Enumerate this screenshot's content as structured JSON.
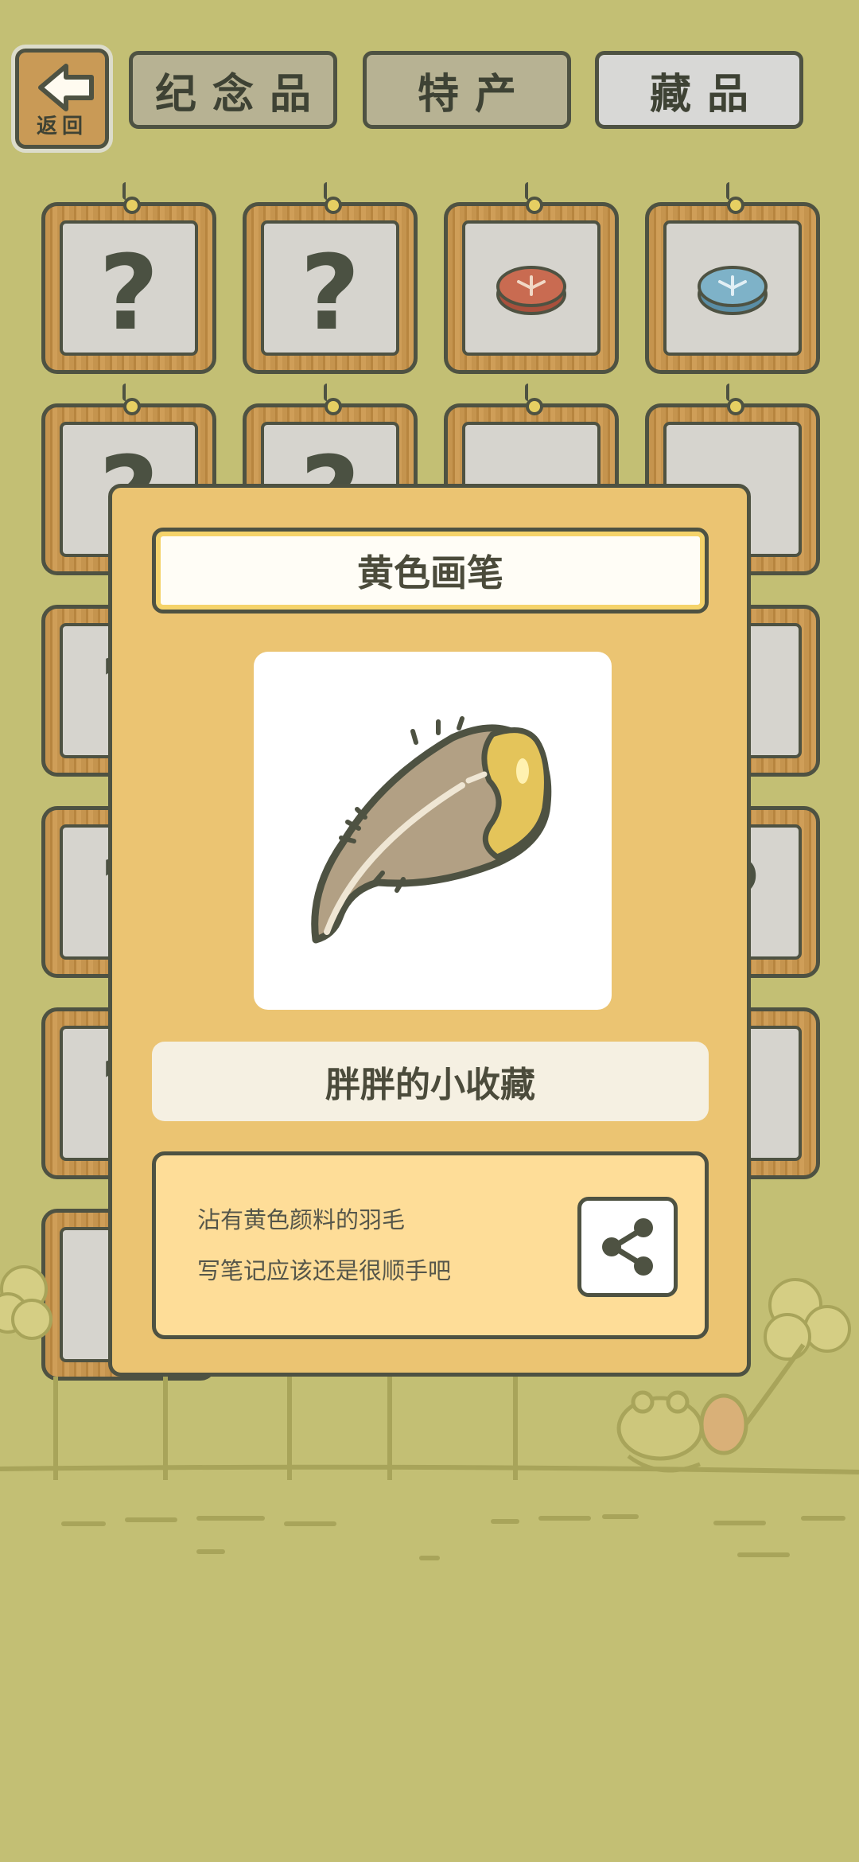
{
  "header": {
    "back_label": "返回",
    "tabs": [
      {
        "label": "纪念品",
        "active": false
      },
      {
        "label": "特产",
        "active": false
      },
      {
        "label": "藏品",
        "active": true
      }
    ]
  },
  "grid": {
    "question_mark": "?"
  },
  "modal": {
    "title": "黄色画笔",
    "item_icon": "yellow-feather-brush",
    "subtitle": "胖胖的小收藏",
    "description_lines": [
      "沾有黄色颜料的羽毛",
      "写笔记应该还是很顺手吧"
    ],
    "share_icon": "share-icon"
  },
  "colors": {
    "background": "#c3bf74",
    "modal": "#ebc472",
    "desc_box": "#fedd98",
    "outline": "#4e5242"
  }
}
